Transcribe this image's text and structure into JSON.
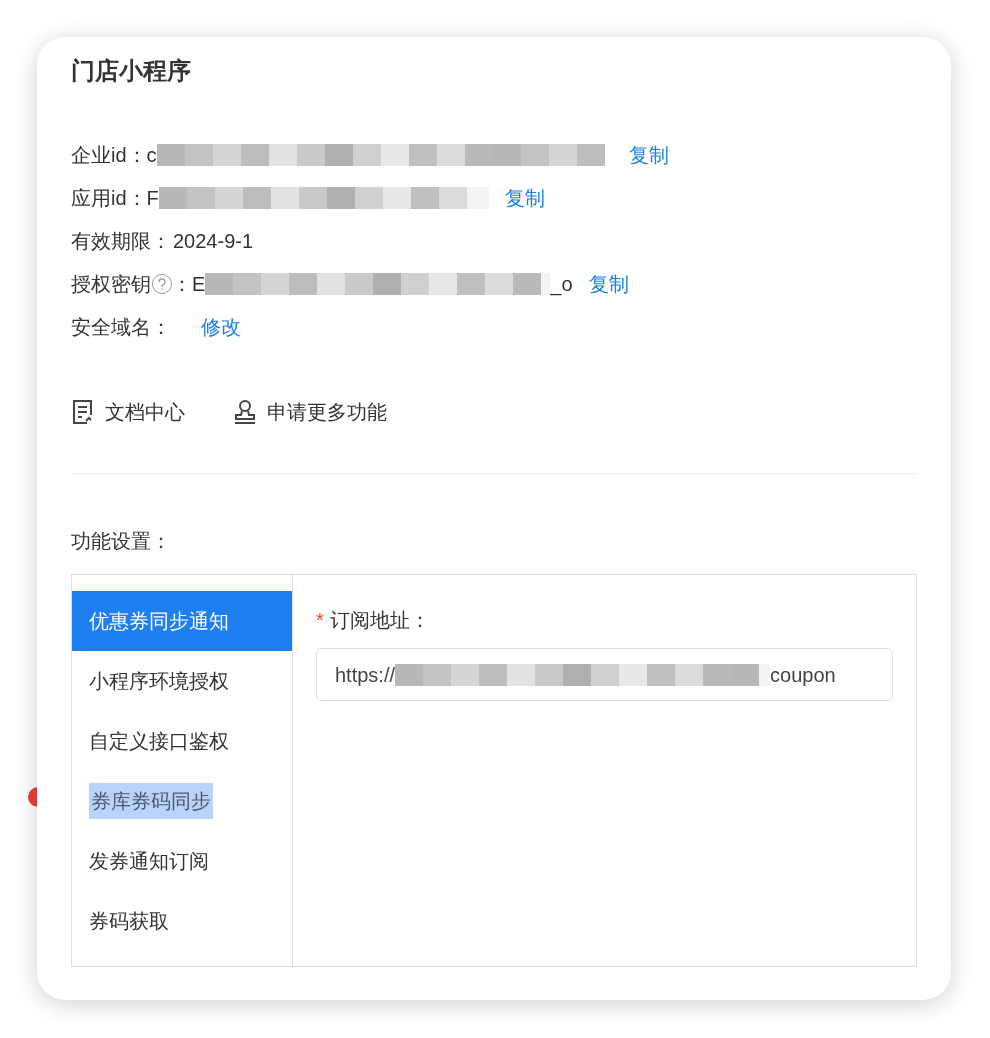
{
  "title": "门店小程序",
  "info_rows": [
    {
      "label": "企业id：",
      "value": "c",
      "redacted": true,
      "action": "复制"
    },
    {
      "label": "应用id：",
      "value": "F",
      "redacted": true,
      "action": "复制"
    },
    {
      "label": "有效期限：",
      "value": "2024-9-1",
      "redacted": false
    },
    {
      "label": "授权密钥",
      "help": true,
      "colon": "：",
      "value": "E",
      "redacted": true,
      "value_end": "_o",
      "action": "复制"
    },
    {
      "label": "安全域名：",
      "redacted": false,
      "action": "修改"
    }
  ],
  "links": [
    {
      "kind": "document",
      "label": "文档中心"
    },
    {
      "kind": "stamp",
      "label": "申请更多功能"
    }
  ],
  "section_label": "功能设置：",
  "menu": [
    {
      "label": "优惠券同步通知",
      "selected": true,
      "highlighted": false
    },
    {
      "label": "小程序环境授权",
      "selected": false,
      "highlighted": false
    },
    {
      "label": "自定义接口鉴权",
      "selected": false,
      "highlighted": false
    },
    {
      "label": "券库券码同步",
      "selected": false,
      "highlighted": true
    },
    {
      "label": "发券通知订阅",
      "selected": false,
      "highlighted": false
    },
    {
      "label": "券码获取",
      "selected": false,
      "highlighted": false
    }
  ],
  "form": {
    "label": "订阅地址：",
    "required_mark": "*",
    "value": "https://",
    "redacted": true,
    "value_end": "coupon"
  }
}
